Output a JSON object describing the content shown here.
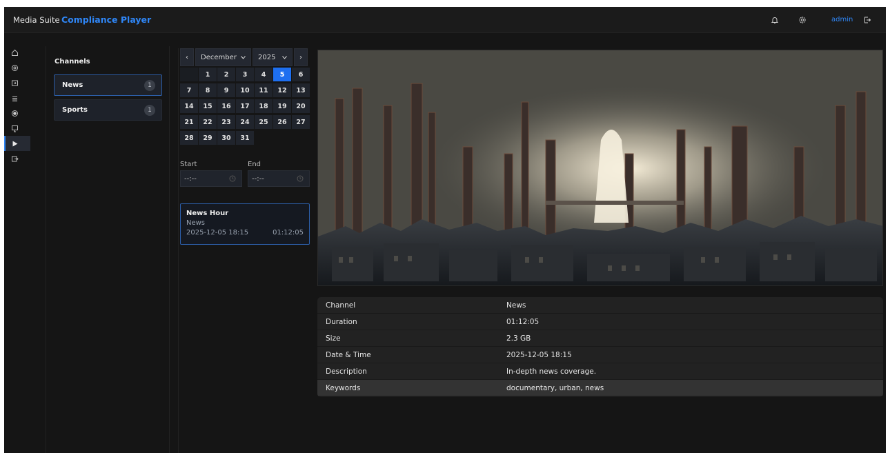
{
  "header": {
    "brand": "Media Suite",
    "app_title": "Compliance Player",
    "user": "admin",
    "icons": [
      "bell-icon",
      "gear-icon",
      "logout-icon"
    ]
  },
  "sidebar": {
    "items": [
      {
        "icon": "home-icon"
      },
      {
        "icon": "dashboard-icon"
      },
      {
        "icon": "import-icon"
      },
      {
        "icon": "list-icon"
      },
      {
        "icon": "record-icon"
      },
      {
        "icon": "monitor-icon"
      },
      {
        "icon": "play-icon",
        "active": true
      },
      {
        "icon": "export-icon"
      }
    ]
  },
  "channels": {
    "heading": "Channels",
    "items": [
      {
        "name": "News",
        "count": "1",
        "active": true
      },
      {
        "name": "Sports",
        "count": "1",
        "active": false
      }
    ]
  },
  "calendar": {
    "prev_label": "‹",
    "next_label": "›",
    "month": "December",
    "year": "2025",
    "selected_day": "5",
    "leading_blanks": 1,
    "days": [
      "1",
      "2",
      "3",
      "4",
      "5",
      "6",
      "7",
      "8",
      "9",
      "10",
      "11",
      "12",
      "13",
      "14",
      "15",
      "16",
      "17",
      "18",
      "19",
      "20",
      "21",
      "22",
      "23",
      "24",
      "25",
      "26",
      "27",
      "28",
      "29",
      "30",
      "31"
    ],
    "start_label": "Start",
    "end_label": "End",
    "start_value": "--:--",
    "end_value": "--:--"
  },
  "program": {
    "title": "News Hour",
    "channel": "News",
    "datetime": "2025-12-05 18:15",
    "duration": "01:12:05"
  },
  "metadata": {
    "rows": [
      {
        "key": "Channel",
        "value": "News"
      },
      {
        "key": "Duration",
        "value": "01:12:05"
      },
      {
        "key": "Size",
        "value": "2.3 GB"
      },
      {
        "key": "Date & Time",
        "value": "2025-12-05 18:15"
      },
      {
        "key": "Description",
        "value": "In-depth news coverage."
      },
      {
        "key": "Keywords",
        "value": "documentary, urban, news",
        "highlighted": true
      }
    ]
  },
  "colors": {
    "accent": "#2f86f6",
    "selected_day": "#1e6ff0",
    "background": "#151515"
  }
}
